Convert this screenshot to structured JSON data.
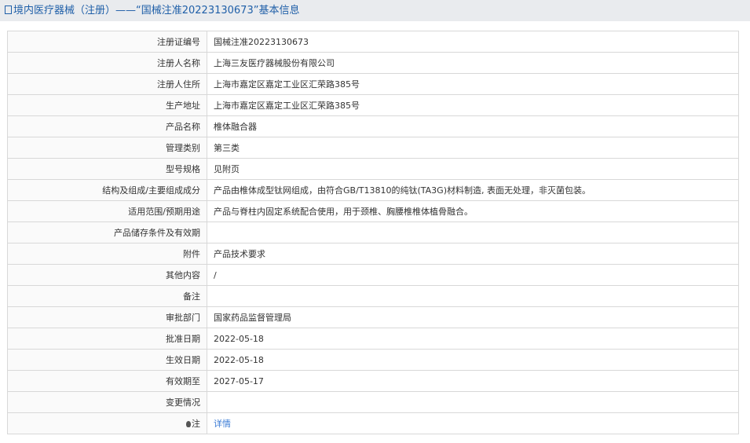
{
  "header": {
    "title": "境内医疗器械（注册）——“国械注准20223130673”基本信息"
  },
  "rows": [
    {
      "label": "注册证编号",
      "value": "国械注准20223130673"
    },
    {
      "label": "注册人名称",
      "value": "上海三友医疗器械股份有限公司"
    },
    {
      "label": "注册人住所",
      "value": "上海市嘉定区嘉定工业区汇荣路385号"
    },
    {
      "label": "生产地址",
      "value": "上海市嘉定区嘉定工业区汇荣路385号"
    },
    {
      "label": "产品名称",
      "value": "椎体融合器"
    },
    {
      "label": "管理类别",
      "value": "第三类"
    },
    {
      "label": "型号规格",
      "value": "见附页"
    },
    {
      "label": "结构及组成/主要组成成分",
      "value": "产品由椎体成型钛网组成，由符合GB/T13810的纯钛(TA3G)材料制造, 表面无处理，非灭菌包装。"
    },
    {
      "label": "适用范围/预期用途",
      "value": "产品与脊柱内固定系统配合使用，用于颈椎、胸腰椎椎体植骨融合。"
    },
    {
      "label": "产品储存条件及有效期",
      "value": ""
    },
    {
      "label": "附件",
      "value": "产品技术要求"
    },
    {
      "label": "其他内容",
      "value": "/"
    },
    {
      "label": "备注",
      "value": ""
    },
    {
      "label": "审批部门",
      "value": "国家药品监督管理局"
    },
    {
      "label": "批准日期",
      "value": "2022-05-18"
    },
    {
      "label": "生效日期",
      "value": "2022-05-18"
    },
    {
      "label": "有效期至",
      "value": "2027-05-17"
    },
    {
      "label": "变更情况",
      "value": ""
    }
  ],
  "note": {
    "label": "注",
    "link": "详情"
  }
}
